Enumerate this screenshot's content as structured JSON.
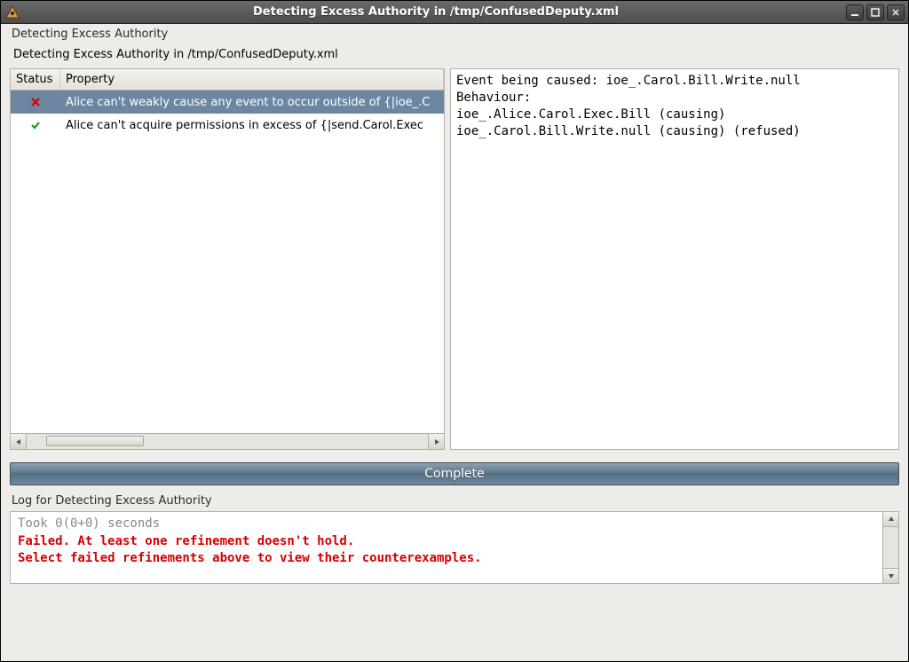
{
  "window": {
    "title": "Detecting Excess Authority in /tmp/ConfusedDeputy.xml"
  },
  "section_label": "Detecting Excess Authority",
  "subtitle": "Detecting Excess Authority in /tmp/ConfusedDeputy.xml",
  "table": {
    "header_status": "Status",
    "header_property": "Property",
    "rows": [
      {
        "status": "fail",
        "property": "Alice can't weakly cause any event to occur outside of {|ioe_.C"
      },
      {
        "status": "pass",
        "property": "Alice can't acquire permissions in excess of {|send.Carol.Exec"
      }
    ]
  },
  "detail": {
    "lines": [
      "Event being caused: ioe_.Carol.Bill.Write.null",
      "Behaviour:",
      "ioe_.Alice.Carol.Exec.Bill (causing)",
      "ioe_.Carol.Bill.Write.null (causing) (refused)"
    ]
  },
  "complete_label": "Complete",
  "log_label": "Log for Detecting Excess Authority",
  "log": {
    "lines": [
      {
        "style": "gray",
        "text": "Took 0(0+0) seconds"
      },
      {
        "style": "red",
        "text": "Failed. At least one refinement doesn't hold."
      },
      {
        "style": "red",
        "text": "Select failed refinements above to view their counterexamples."
      }
    ]
  }
}
